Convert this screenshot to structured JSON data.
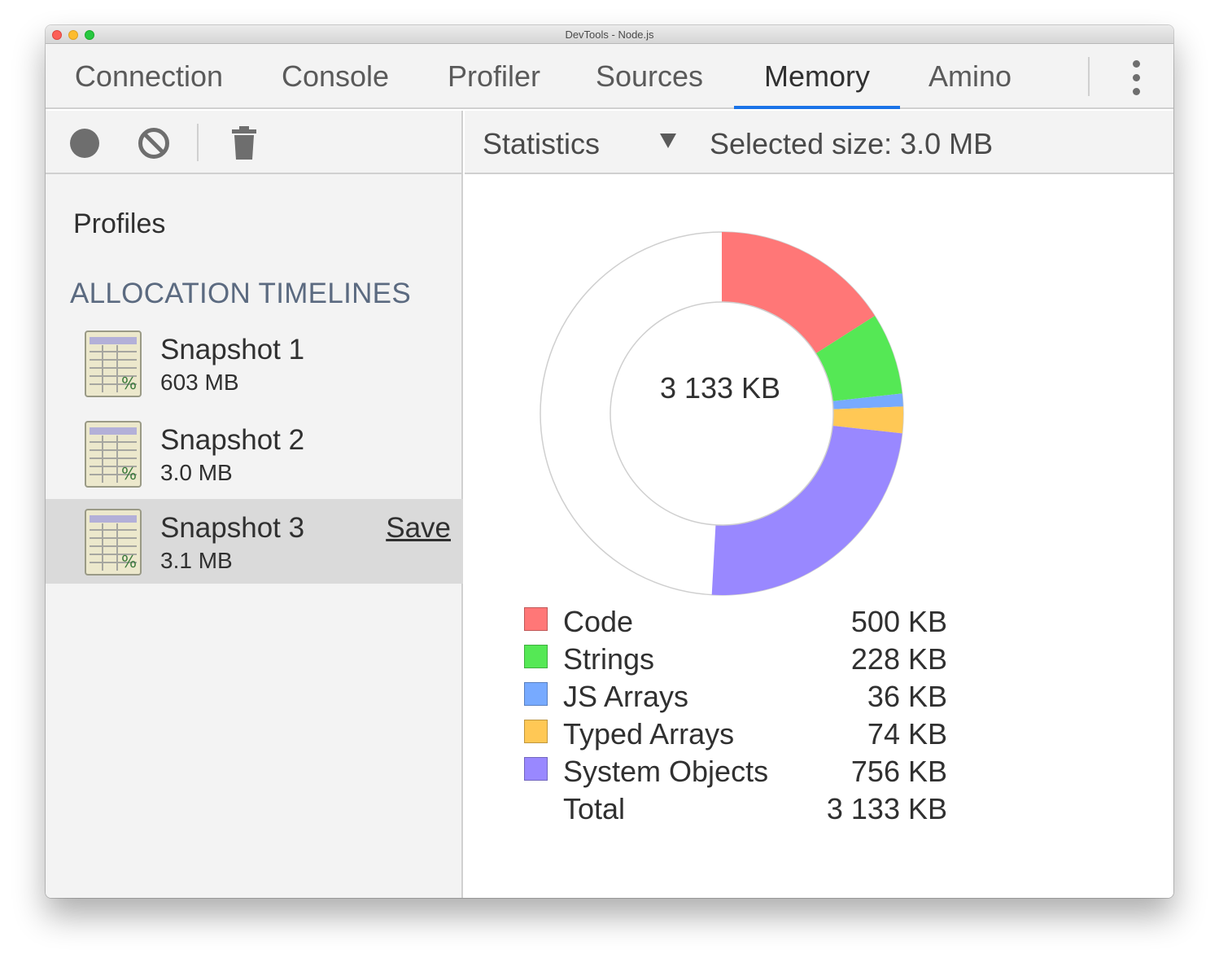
{
  "window": {
    "title": "DevTools - Node.js"
  },
  "tabs": [
    {
      "label": "Connection",
      "active": false
    },
    {
      "label": "Console",
      "active": false
    },
    {
      "label": "Profiler",
      "active": false
    },
    {
      "label": "Sources",
      "active": false
    },
    {
      "label": "Memory",
      "active": true
    },
    {
      "label": "Amino",
      "active": false
    }
  ],
  "sidebar": {
    "heading": "Profiles",
    "section": "ALLOCATION TIMELINES",
    "snapshots": [
      {
        "title": "Snapshot 1",
        "size": "603 MB",
        "selected": false
      },
      {
        "title": "Snapshot 2",
        "size": "3.0 MB",
        "selected": false
      },
      {
        "title": "Snapshot 3",
        "size": "3.1 MB",
        "selected": true,
        "action": "Save"
      }
    ]
  },
  "toolbar": {
    "view": "Statistics",
    "selected_size_label": "Selected size:",
    "selected_size_value": "3.0 MB"
  },
  "icons": {
    "record": "record-icon",
    "clear": "clear-icon",
    "trash": "trash-icon",
    "menu": "kebab-menu-icon",
    "snapshot": "heap-snapshot-icon",
    "dropdown": "dropdown-arrow-icon"
  },
  "colors": {
    "accent": "#1a73e8"
  },
  "chart_data": {
    "type": "pie",
    "center_label": "3 133 KB",
    "total": 3133,
    "unit": "KB",
    "categories": [
      "Code",
      "Strings",
      "JS Arrays",
      "Typed Arrays",
      "System Objects"
    ],
    "values": [
      500,
      228,
      36,
      74,
      756
    ],
    "labels": [
      "500 KB",
      "228 KB",
      "36 KB",
      "74 KB",
      "756 KB"
    ],
    "colors": [
      "#ff7777",
      "#55e855",
      "#77aaff",
      "#ffc855",
      "#9988ff"
    ],
    "total_row": {
      "name": "Total",
      "value": "3 133 KB"
    }
  }
}
